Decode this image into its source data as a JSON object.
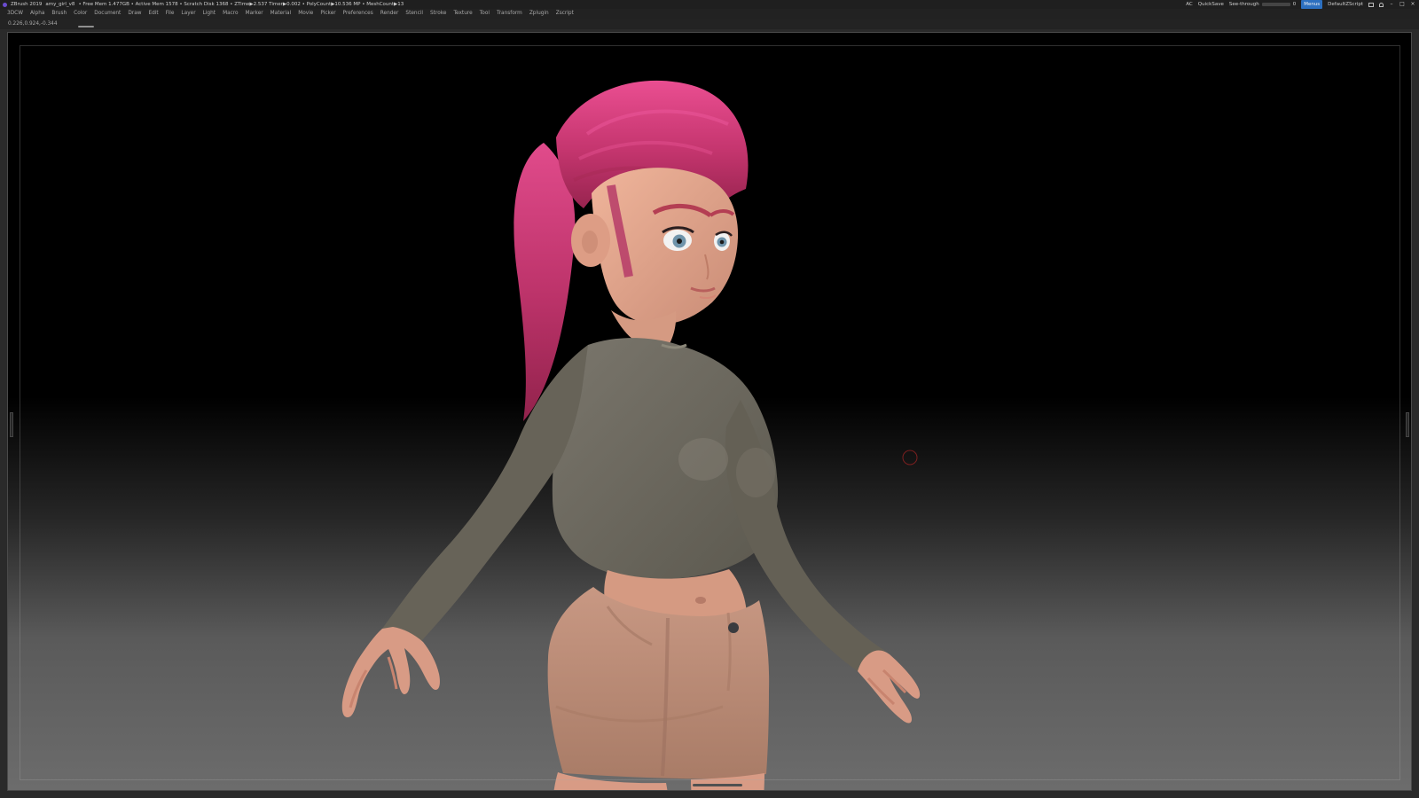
{
  "titlebar": {
    "app_name": "ZBrush 2019",
    "file_name": "amy_girl_v8",
    "stats": "• Free Mem 1.477GB • Active Mem 1578 • Scratch Disk 1368 • ZTime▶2.537 Timer▶0.002 • PolyCount▶10.536 MP • MeshCount▶13",
    "right": {
      "ac": "AC",
      "quicksave": "QuickSave",
      "see_through_label": "See-through",
      "see_through_value": "0",
      "menus_label": "Menus",
      "script_label": "DefaultZScript"
    }
  },
  "menubar": {
    "items": [
      "3DCW",
      "Alpha",
      "Brush",
      "Color",
      "Document",
      "Draw",
      "Edit",
      "File",
      "Layer",
      "Light",
      "Macro",
      "Marker",
      "Material",
      "Movie",
      "Picker",
      "Preferences",
      "Render",
      "Stencil",
      "Stroke",
      "Texture",
      "Tool",
      "Transform",
      "Zplugin",
      "Zscript"
    ]
  },
  "statusline": {
    "coords": "0.226,0.924,-0.344"
  },
  "colors": {
    "hair": "#c2336f",
    "shirt": "#6f6b60",
    "shorts": "#b98672",
    "skin": "#d89f87",
    "menus_active": "#2c6fbf",
    "cursor_ring": "#7b1f1f"
  },
  "icons": {
    "app": "zbrush-logo-icon",
    "minimize": "minimize-icon",
    "maximize": "maximize-icon",
    "close": "close-icon",
    "layout": "layout-icon",
    "lock": "lock-icon"
  }
}
